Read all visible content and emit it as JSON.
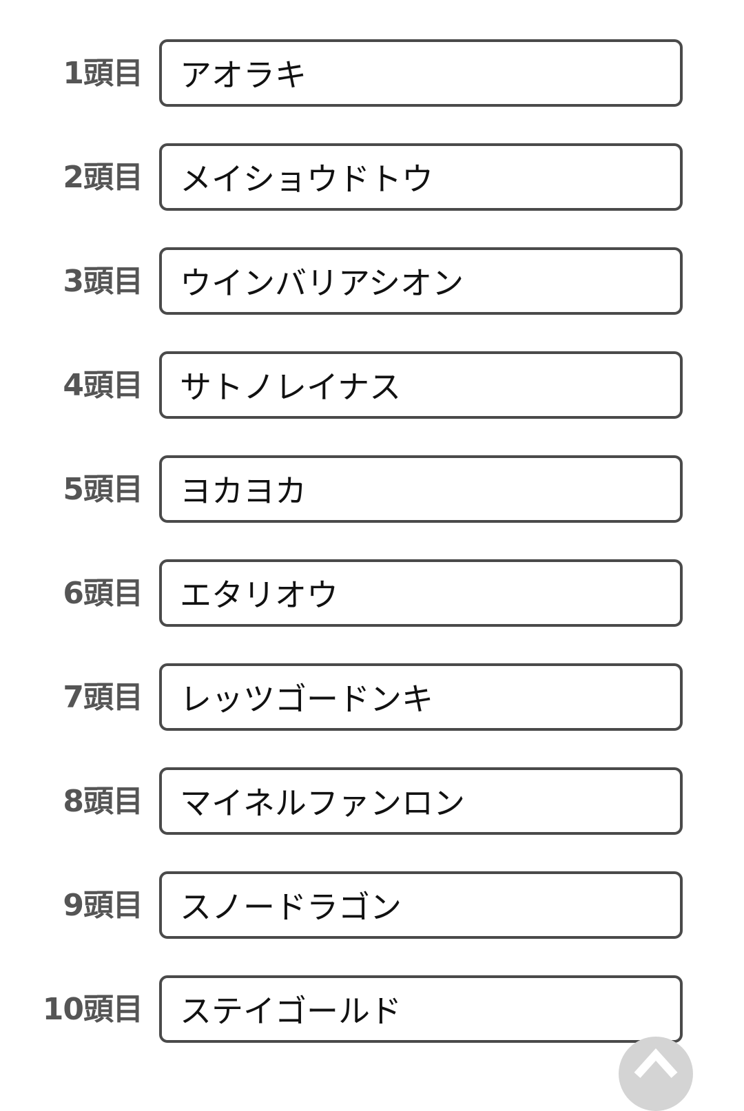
{
  "entries": [
    {
      "label": "1頭目",
      "value": "アオラキ"
    },
    {
      "label": "2頭目",
      "value": "メイショウドトウ"
    },
    {
      "label": "3頭目",
      "value": "ウインバリアシオン"
    },
    {
      "label": "4頭目",
      "value": "サトノレイナス"
    },
    {
      "label": "5頭目",
      "value": "ヨカヨカ"
    },
    {
      "label": "6頭目",
      "value": "エタリオウ"
    },
    {
      "label": "7頭目",
      "value": "レッツゴードンキ"
    },
    {
      "label": "8頭目",
      "value": "マイネルファンロン"
    },
    {
      "label": "9頭目",
      "value": "スノードラゴン"
    },
    {
      "label": "10頭目",
      "value": "ステイゴールド"
    }
  ],
  "scroll_top_button": {
    "icon": "chevron-up-icon"
  },
  "colors": {
    "label_text": "#555555",
    "input_border": "#4a4a4a",
    "scroll_button_bg": "#d4d4d4"
  }
}
